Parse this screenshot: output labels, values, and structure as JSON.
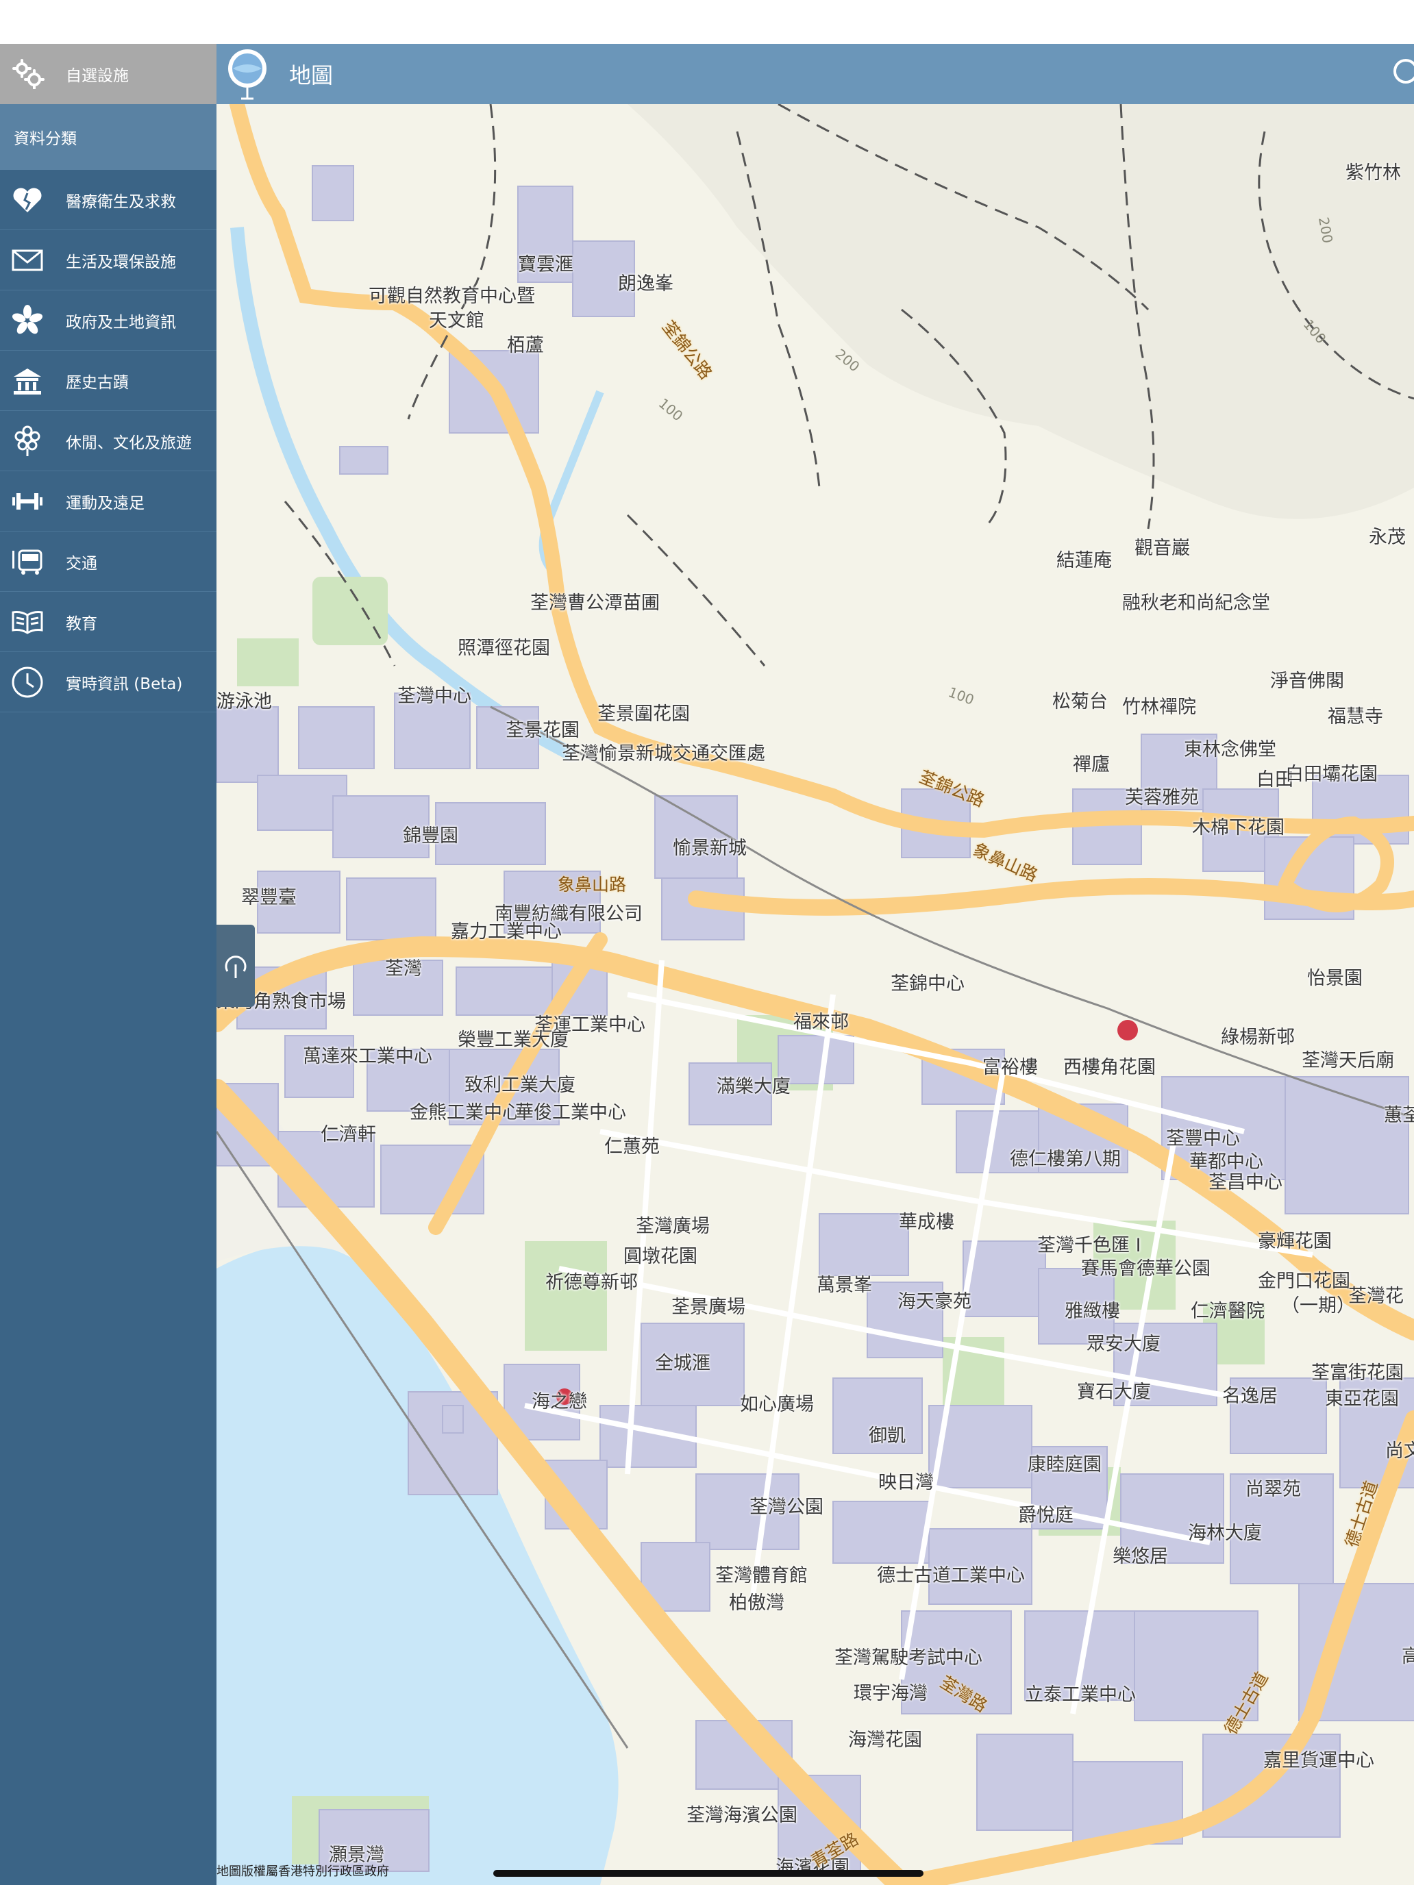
{
  "sidebar": {
    "favorites_label": "自選設施",
    "header": "資料分類",
    "items": [
      {
        "label": "醫療衛生及求救",
        "icon": "heart-icon"
      },
      {
        "label": "生活及環保設施",
        "icon": "envelope-icon"
      },
      {
        "label": "政府及土地資訊",
        "icon": "bauhinia-icon"
      },
      {
        "label": "歷史古蹟",
        "icon": "monument-icon"
      },
      {
        "label": "休閒、文化及旅遊",
        "icon": "flower-icon"
      },
      {
        "label": "運動及遠足",
        "icon": "dumbbell-icon"
      },
      {
        "label": "交通",
        "icon": "bus-icon"
      },
      {
        "label": "教育",
        "icon": "book-icon"
      },
      {
        "label": "實時資訊 (Beta)",
        "icon": "clock-icon"
      }
    ]
  },
  "topbar": {
    "title": "地圖"
  },
  "map": {
    "copyright": "地圖版權屬香港特別行政區政府",
    "place_labels": [
      "紫竹林",
      "寶雲滙",
      "朗逸峯",
      "可觀自然教育中心暨",
      "天文館",
      "栢蘆",
      "結蓮庵",
      "觀音巖",
      "永茂",
      "融秋老和尚紀念堂",
      "荃灣曹公潭苗圃",
      "照潭徑花園",
      "淨音佛閣",
      "荃灣中心",
      "游泳池",
      "荃景圍花園",
      "荃景花園",
      "荃灣愉景新城交通交匯處",
      "松菊台",
      "竹林禪院",
      "福慧寺",
      "東林念佛堂",
      "禪廬",
      "白田",
      "白田壩花園",
      "芙蓉雅苑",
      "木棉下花園",
      "錦豐園",
      "愉景新城",
      "翠豐臺",
      "南豐紡織有限公司",
      "嘉力工業中心",
      "荃灣",
      "荃錦中心",
      "怡景園",
      "柴灣角熟食市場",
      "荃運工業中心",
      "福來邨",
      "綠楊新邨",
      "榮豐工業大廈",
      "萬達來工業中心",
      "富裕樓",
      "西樓角花園",
      "荃灣天后廟",
      "致利工業大廈",
      "滿樂大廈",
      "蕙荃",
      "金熊工業中心",
      "華俊工業中心",
      "仁濟軒",
      "仁蕙苑",
      "荃豐中心",
      "德仁樓第八期",
      "華都中心",
      "荃昌中心",
      "荃灣廣場",
      "華成樓",
      "荃灣千色匯 I",
      "豪輝花園",
      "圓墩花園",
      "賽馬會德華公園",
      "金門口花園",
      "祈德尊新邨",
      "萬景峯",
      "海天豪苑",
      "雅緻樓",
      "仁濟醫院",
      "（一期）",
      "荃灣花",
      "荃景廣場",
      "眾安大廈",
      "全城滙",
      "荃富街花園",
      "海之戀",
      "如心廣場",
      "寶石大廈",
      "名逸居",
      "東亞花園",
      "御凱",
      "康睦庭園",
      "尚文",
      "映日灣",
      "尚翠苑",
      "荃灣公園",
      "爵悅庭",
      "海林大廈",
      "荃灣體育館",
      "德士古道工業中心",
      "樂悠居",
      "柏傲灣",
      "荃灣駕駛考試中心",
      "高",
      "環宇海灣",
      "立泰工業中心",
      "海灣花園",
      "嘉里貨運中心",
      "荃灣海濱公園",
      "灝景灣",
      "海濱花園"
    ],
    "road_labels": [
      "荃錦公路",
      "荃錦公路",
      "象鼻山路",
      "象鼻山路",
      "荃灣路",
      "德士古道",
      "德士古道",
      "青荃路"
    ],
    "contour_labels": [
      "200",
      "100",
      "200",
      "100",
      "100"
    ]
  }
}
